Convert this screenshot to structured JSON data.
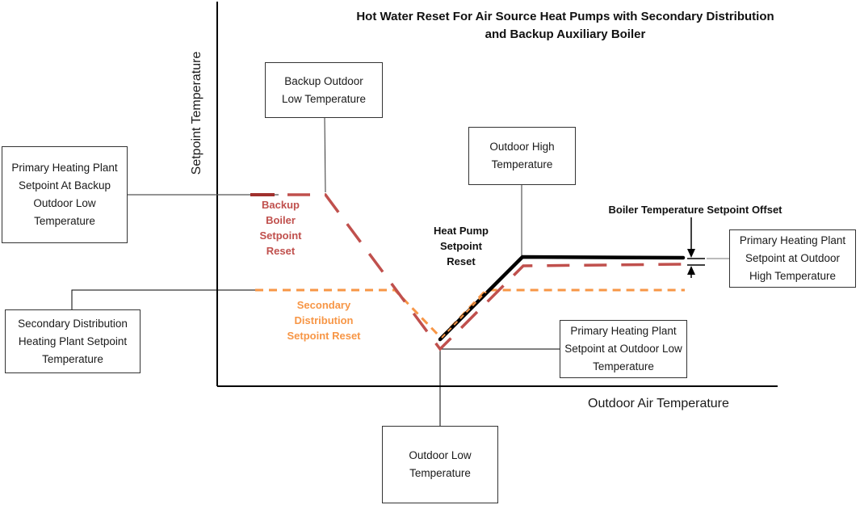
{
  "title": "Hot Water Reset For Air Source Heat Pumps with Secondary Distribution and Backup Auxiliary Boiler",
  "axes": {
    "x_label": "Outdoor Air Temperature",
    "y_label": "Setpoint Temperature"
  },
  "boxes": {
    "backup_outdoor_low": "Backup Outdoor Low Temperature",
    "primary_at_backup_low": "Primary Heating Plant Setpoint At Backup Outdoor Low Temperature",
    "outdoor_high": "Outdoor High Temperature",
    "primary_at_outdoor_high": "Primary Heating Plant Setpoint at Outdoor High Temperature",
    "secondary_distribution_setpoint": "Secondary Distribution Heating Plant Setpoint Temperature",
    "primary_at_outdoor_low": "Primary Heating Plant Setpoint at Outdoor Low Temperature",
    "outdoor_low": "Outdoor Low Temperature"
  },
  "labels": {
    "backup_boiler_reset": "Backup Boiler Setpoint Reset",
    "secondary_reset": "Secondary Distribution Setpoint Reset",
    "heat_pump_reset": "Heat Pump Setpoint Reset",
    "boiler_offset": "Boiler Temperature Setpoint Offset"
  },
  "colors": {
    "heat_pump": "#000000",
    "backup_boiler": "#c0504d",
    "secondary": "#f79646",
    "axis": "#000000"
  }
}
